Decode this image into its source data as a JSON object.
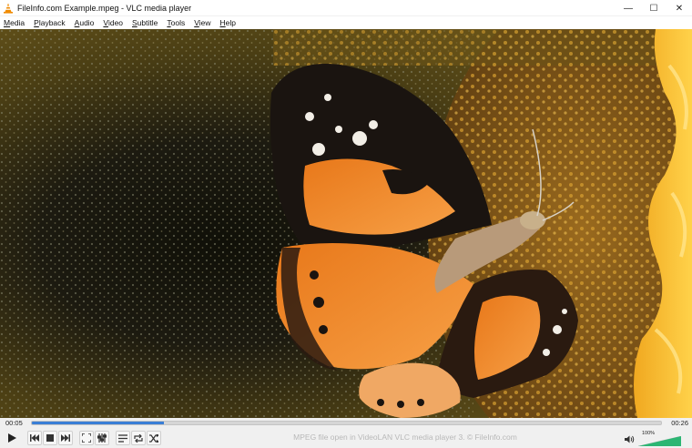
{
  "window": {
    "title": "FileInfo.com Example.mpeg - VLC media player",
    "controls": {
      "minimize": "—",
      "maximize": "☐",
      "close": "✕"
    }
  },
  "menu": [
    {
      "label": "Media",
      "underline": "M",
      "rest": "edia"
    },
    {
      "label": "Playback",
      "underline": "P",
      "rest": "layback"
    },
    {
      "label": "Audio",
      "underline": "A",
      "rest": "udio"
    },
    {
      "label": "Video",
      "underline": "V",
      "rest": "ideo"
    },
    {
      "label": "Subtitle",
      "underline": "S",
      "rest": "ubtitle"
    },
    {
      "label": "Tools",
      "underline": "T",
      "rest": "ools"
    },
    {
      "label": "View",
      "underline": "V",
      "rest": "iew"
    },
    {
      "label": "Help",
      "underline": "H",
      "rest": "elp"
    }
  ],
  "playback": {
    "elapsed": "00:05",
    "total": "00:26",
    "progress_fraction": 0.21
  },
  "status_text": "MPEG file open in VideoLAN VLC media player 3. © FileInfo.com",
  "volume": {
    "label": "100%",
    "level_fraction": 1.0
  },
  "colors": {
    "accent": "#3a7fd6",
    "volume_green": "#2bb673",
    "vlc_orange": "#f08a00"
  },
  "icons": [
    "vlc-cone-icon",
    "play-icon",
    "previous-icon",
    "stop-icon",
    "next-icon",
    "fullscreen-icon",
    "extended-settings-icon",
    "playlist-icon",
    "loop-icon",
    "shuffle-icon",
    "speaker-icon"
  ]
}
